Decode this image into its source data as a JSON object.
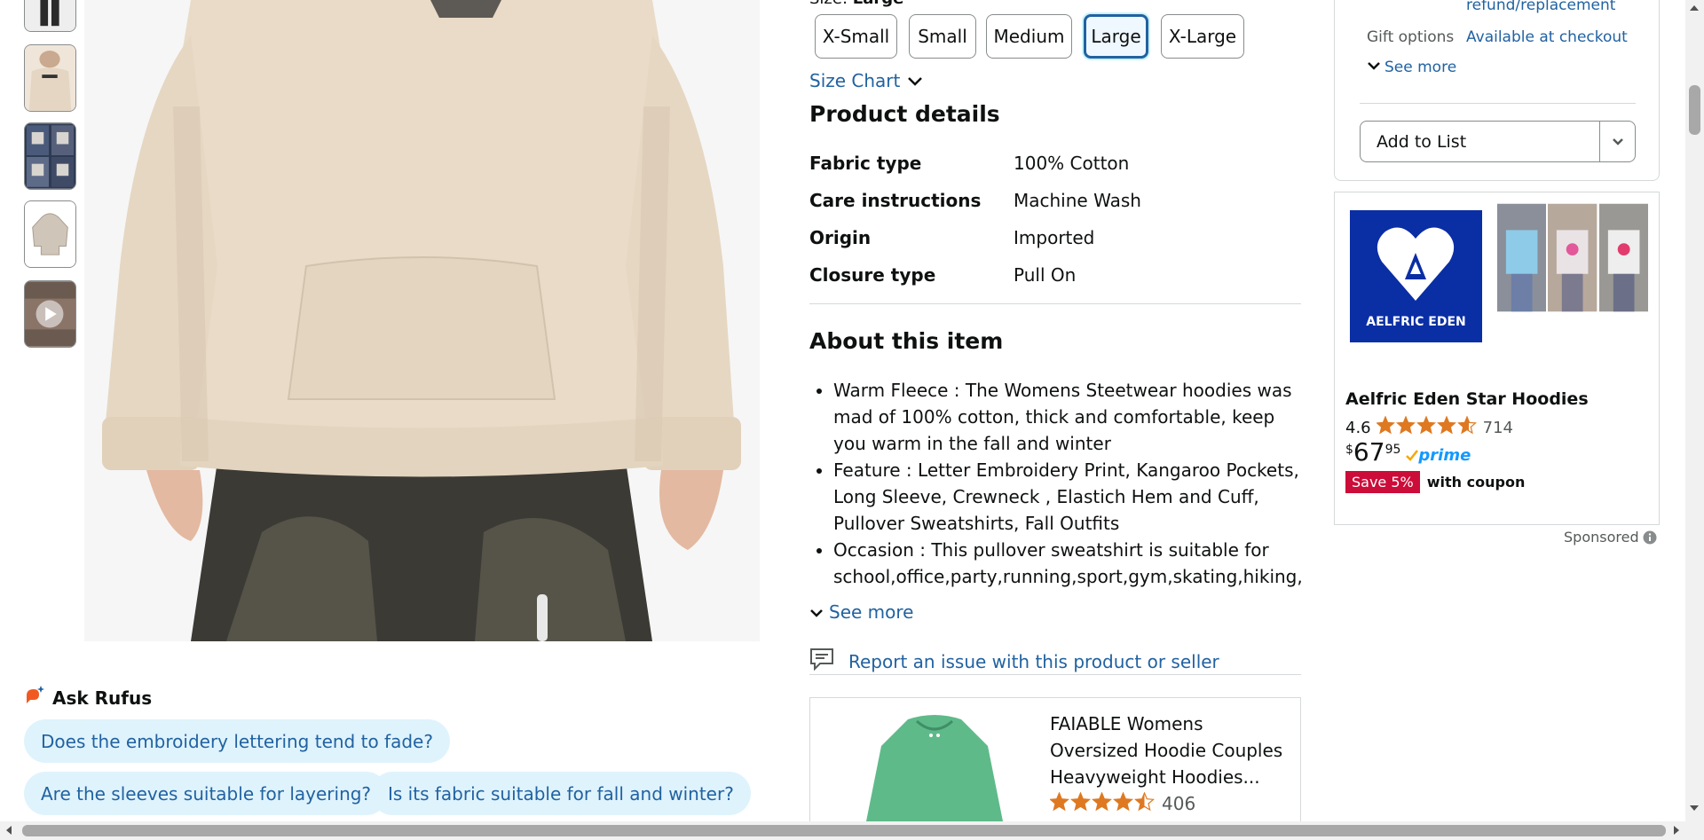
{
  "size": {
    "label_prefix": "Size:",
    "selected": "Large",
    "options": [
      "X-Small",
      "Small",
      "Medium",
      "Large",
      "X-Large"
    ],
    "size_chart": "Size Chart"
  },
  "product_details": {
    "heading": "Product details",
    "rows": [
      {
        "key": "Fabric type",
        "value": "100% Cotton"
      },
      {
        "key": "Care instructions",
        "value": "Machine Wash"
      },
      {
        "key": "Origin",
        "value": "Imported"
      },
      {
        "key": "Closure type",
        "value": "Pull On"
      }
    ]
  },
  "about": {
    "heading": "About this item",
    "bullets": [
      "Warm Fleece : The Womens Steetwear hoodies was mad of 100% cotton, thick and comfortable, keep you warm in the fall and winter",
      "Feature : Letter Embroidery Print, Kangaroo Pockets, Long Sleeve, Crewneck , Elastich Hem and Cuff, Pullover Sweatshirts, Fall Outfits",
      "Occasion : This pullover sweatshirt is suitable for school,office,party,running,sport,gym,skating,hiking,bi"
    ],
    "see_more": "See more"
  },
  "report": "Report an issue with this product or seller",
  "rufus": {
    "title": "Ask Rufus",
    "questions": [
      "Does the embroidery lettering tend to fade?",
      "Are the sleeves suitable for layering?",
      "Is its fabric suitable for fall and winter?"
    ]
  },
  "buybox": {
    "refund": "refund/replacement",
    "gift_label": "Gift options",
    "gift_value": "Available at checkout",
    "see_more": "See more",
    "add_to_list": "Add to List"
  },
  "ad": {
    "brand_logo_text": "AELFRIC EDEN",
    "title": "Aelfric Eden Star Hoodies",
    "rating": "4.6",
    "rating_value": 4.6,
    "review_count": "714",
    "price_symbol": "$",
    "price_whole": "67",
    "price_fraction": "95",
    "prime": "prime",
    "badge": "Save 5%",
    "coupon": "with coupon",
    "sponsored": "Sponsored"
  },
  "sponsored_product": {
    "title": "FAIABLE Womens Oversized Hoodie Couples Heavyweight Hoodies...",
    "rating_value": 4.5,
    "review_count": "406"
  },
  "colors": {
    "link": "#2162a1",
    "star": "#de7921",
    "badge": "#cc0c39",
    "prime": "#1399ff",
    "brand_blue": "#0a2ea4",
    "chip_bg": "#dff3fc"
  }
}
